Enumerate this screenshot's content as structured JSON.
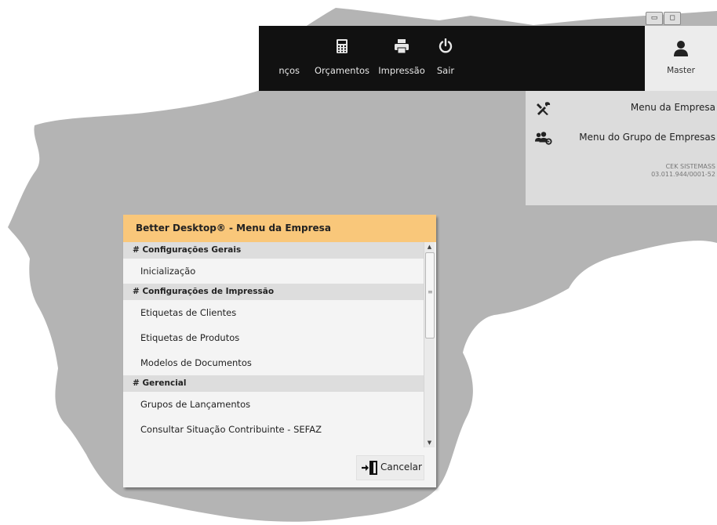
{
  "colors": {
    "backdrop": "#b4b4b4",
    "toolbar_bg": "#111111",
    "dialog_title_bg": "#f9c77a",
    "group_bg": "#dddddd"
  },
  "toolbar": {
    "items": [
      {
        "label": "nços",
        "icon": "services-icon"
      },
      {
        "label": "Orçamentos",
        "icon": "calculator-icon"
      },
      {
        "label": "Impressão",
        "icon": "printer-icon"
      },
      {
        "label": "Sair",
        "icon": "power-icon"
      }
    ],
    "master": {
      "label": "Master",
      "icon": "user-icon"
    }
  },
  "company_menu": {
    "items": [
      {
        "label": "Menu da Empresa",
        "icon": "tools-icon"
      },
      {
        "label": "Menu do Grupo de Empresas",
        "icon": "users-gear-icon"
      }
    ],
    "company_name": "CEK SISTEMASS",
    "company_cnpj": "03.011.944/0001-52"
  },
  "dialog": {
    "title": "Better Desktop® - Menu da Empresa",
    "groups": [
      {
        "title": "# Configurações Gerais",
        "items": [
          "Inicialização"
        ]
      },
      {
        "title": "# Configurações de Impressão",
        "items": [
          "Etiquetas de Clientes",
          "Etiquetas de Produtos",
          "Modelos de Documentos"
        ]
      },
      {
        "title": "# Gerencial",
        "items": [
          "Grupos de Lançamentos",
          "Consultar Situação Contribuinte - SEFAZ"
        ]
      }
    ],
    "cancel_label": "Cancelar"
  }
}
